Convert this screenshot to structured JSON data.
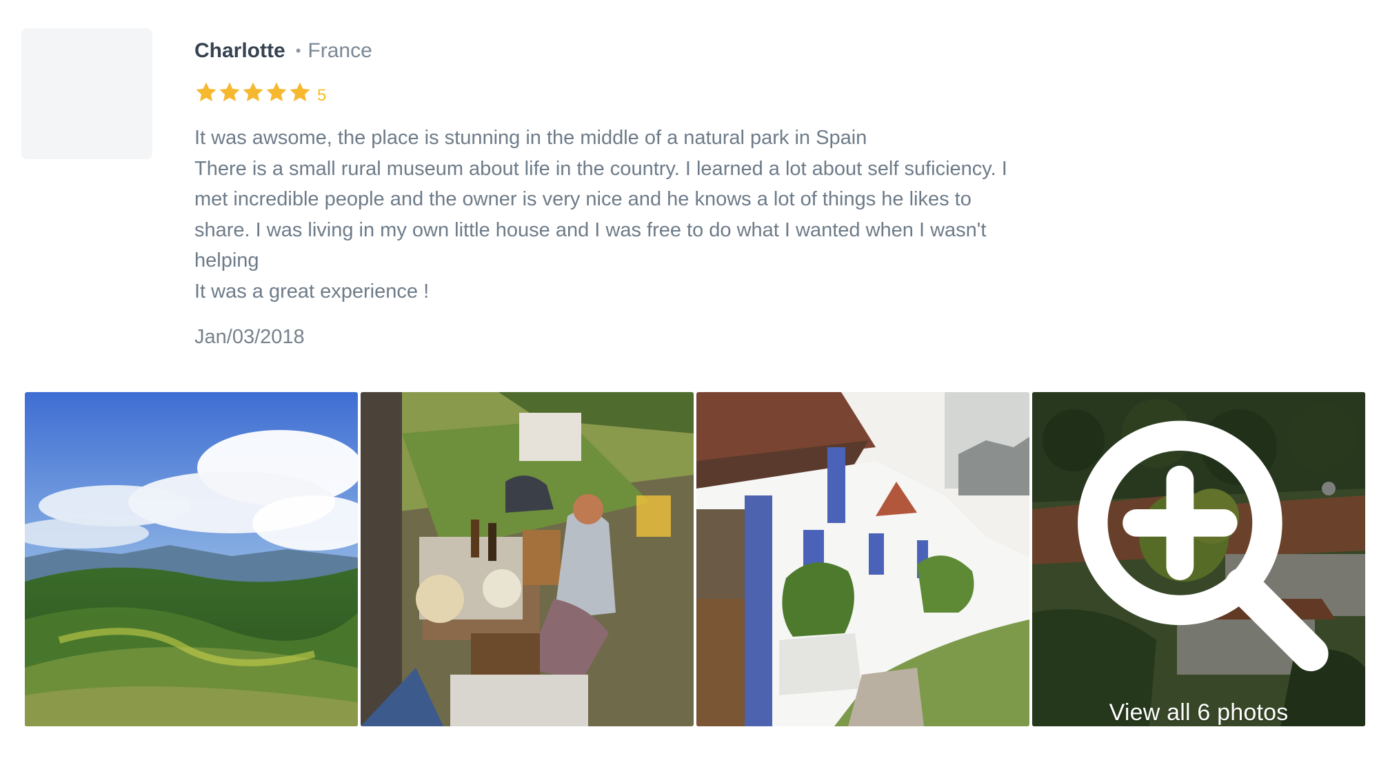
{
  "reviewer": {
    "name": "Charlotte",
    "separator": "•",
    "country": "France"
  },
  "rating": {
    "stars": 5,
    "value": "5"
  },
  "review": {
    "text": "It was awsome, the place is stunning in the middle of a natural park in Spain\nThere is a small rural museum about life in the country. I learned a lot about self suficiency. I\nmet incredible people and the owner is very nice and he knows a lot of things he likes to\nshare. I was living in my own little house and I was free to do what I wanted when I wasn't\nhelping\nIt was a great experience !",
    "date": "Jan/03/2018"
  },
  "gallery": {
    "photos": [
      "mountain-landscape-photo",
      "outdoor-craft-workshop-photo",
      "blue-white-village-houses-photo",
      "village-among-trees-photo"
    ],
    "view_all_label": "View all 6 photos"
  },
  "colors": {
    "star": "#f5b82e",
    "rating_text": "#f2bf1f",
    "name": "#364250",
    "body_text": "#6d7b88"
  }
}
